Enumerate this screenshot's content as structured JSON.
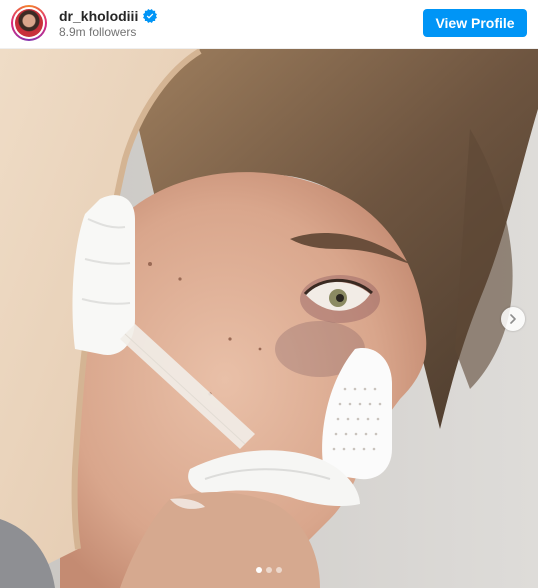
{
  "header": {
    "username": "dr_kholodiii",
    "verified": true,
    "followers": "8.9m followers",
    "view_profile_label": "View Profile"
  },
  "icons": {
    "verified": "verified-badge-icon",
    "next": "chevron-right-icon",
    "avatar": "profile-avatar"
  },
  "carousel": {
    "total_slides": 3,
    "active_slide": 1
  },
  "colors": {
    "accent": "#0095f6",
    "text_primary": "#262626",
    "text_secondary": "#737373"
  }
}
